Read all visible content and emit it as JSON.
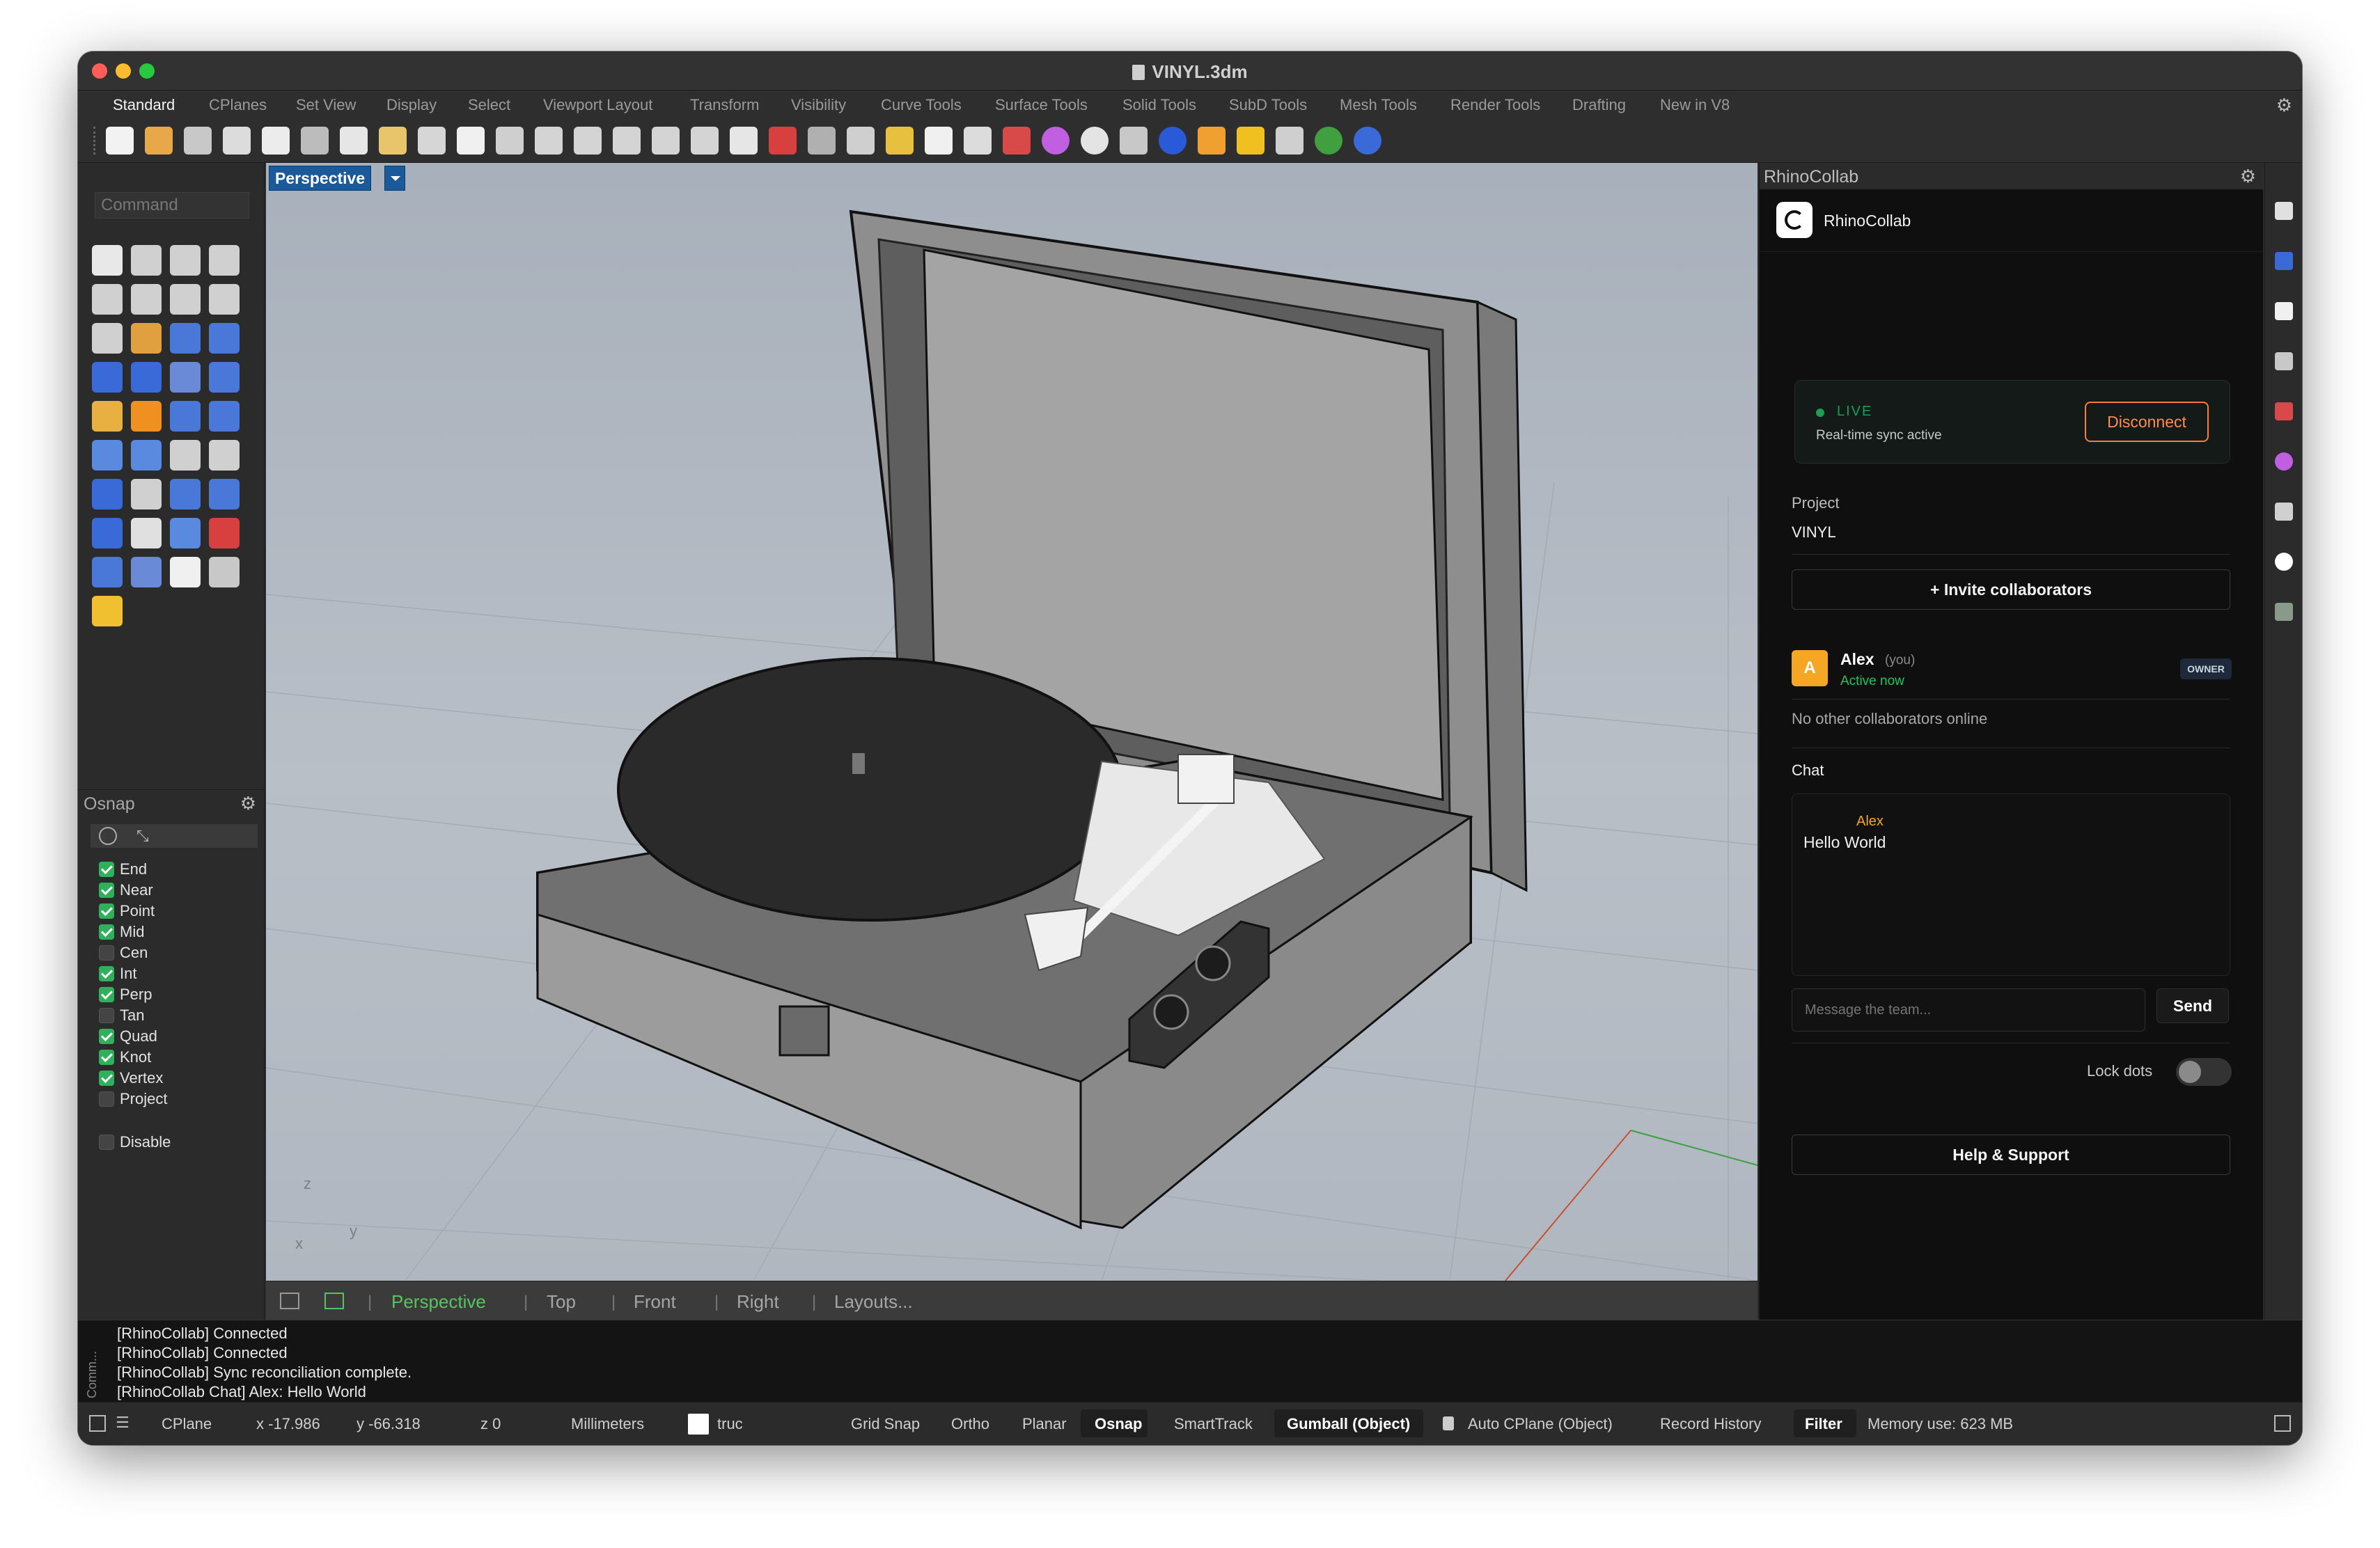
{
  "window": {
    "title": "VINYL.3dm"
  },
  "tabs": [
    "Standard",
    "CPlanes",
    "Set View",
    "Display",
    "Select",
    "Viewport Layout",
    "Transform",
    "Visibility",
    "Curve Tools",
    "Surface Tools",
    "Solid Tools",
    "SubD Tools",
    "Mesh Tools",
    "Render Tools",
    "Drafting",
    "New in V8"
  ],
  "command": {
    "placeholder": "Command"
  },
  "osnap": {
    "title": "Osnap",
    "items": [
      {
        "label": "End",
        "checked": true
      },
      {
        "label": "Near",
        "checked": true
      },
      {
        "label": "Point",
        "checked": true
      },
      {
        "label": "Mid",
        "checked": true
      },
      {
        "label": "Cen",
        "checked": false
      },
      {
        "label": "Int",
        "checked": true
      },
      {
        "label": "Perp",
        "checked": true
      },
      {
        "label": "Tan",
        "checked": false
      },
      {
        "label": "Quad",
        "checked": true
      },
      {
        "label": "Knot",
        "checked": true
      },
      {
        "label": "Vertex",
        "checked": true
      },
      {
        "label": "Project",
        "checked": false
      }
    ],
    "disable_label": "Disable"
  },
  "viewport": {
    "label": "Perspective",
    "axis_z": "z",
    "axis_y": "y",
    "axis_x": "x",
    "tabs": [
      "Perspective",
      "Top",
      "Front",
      "Right",
      "Layouts..."
    ]
  },
  "panel": {
    "title": "RhinoCollab",
    "brand": "RhinoCollab",
    "live_tag": "LIVE",
    "live_sub": "Real-time sync active",
    "disconnect_label": "Disconnect",
    "project_label": "Project",
    "project_name": "VINYL",
    "invite_label": "+ Invite collaborators",
    "user": {
      "initial": "A",
      "name": "Alex",
      "you": "(you)",
      "status": "Active now",
      "role": "OWNER"
    },
    "no_others": "No other collaborators online",
    "chat_label": "Chat",
    "messages": [
      {
        "author": "Alex",
        "text": "Hello World"
      }
    ],
    "message_placeholder": "Message the team...",
    "send_label": "Send",
    "lock_label": "Lock dots",
    "help_label": "Help & Support"
  },
  "command_history": {
    "side_label": "Comm...",
    "lines": [
      "[RhinoCollab] Connected",
      "[RhinoCollab] Connected",
      "[RhinoCollab] Sync reconciliation complete.",
      "[RhinoCollab Chat] Alex: Hello World"
    ]
  },
  "status": {
    "cplane": "CPlane",
    "x": "x -17.986",
    "y": "y -66.318",
    "z": "z 0",
    "units": "Millimeters",
    "layer": "truc",
    "grid_snap": "Grid Snap",
    "ortho": "Ortho",
    "planar": "Planar",
    "osnap": "Osnap",
    "smarttrack": "SmartTrack",
    "gumball": "Gumball (Object)",
    "auto_cplane": "Auto CPlane (Object)",
    "record_history": "Record History",
    "filter": "Filter",
    "memory": "Memory use: 623 MB"
  },
  "colors": {
    "accent_live": "#1f9d55",
    "disconnect": "#ff7a3c",
    "avatar": "#f5a623",
    "viewport_active_tab": "#59c45e"
  }
}
